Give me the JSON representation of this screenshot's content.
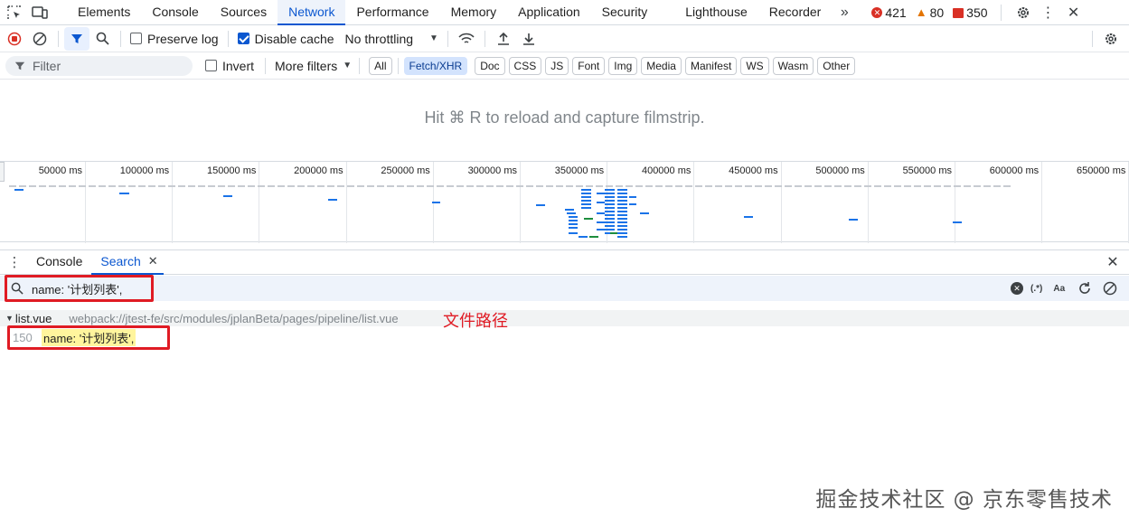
{
  "tabs": [
    "Elements",
    "Console",
    "Sources",
    "Network",
    "Performance",
    "Memory",
    "Application",
    "Security",
    "Lighthouse",
    "Recorder"
  ],
  "active_tab": "Network",
  "counters": {
    "errors": "421",
    "warnings": "80",
    "issues": "350"
  },
  "toolbar": {
    "preserve_log": "Preserve log",
    "disable_cache": "Disable cache",
    "throttling": "No throttling"
  },
  "filterbar": {
    "filter_placeholder": "Filter",
    "invert": "Invert",
    "more_filters": "More filters",
    "chips": [
      "All",
      "Fetch/XHR",
      "Doc",
      "CSS",
      "JS",
      "Font",
      "Img",
      "Media",
      "Manifest",
      "WS",
      "Wasm",
      "Other"
    ],
    "active_chip": "Fetch/XHR"
  },
  "filmstrip_message": "Hit ⌘ R to reload and capture filmstrip.",
  "timeline_ticks": [
    "50000 ms",
    "100000 ms",
    "150000 ms",
    "200000 ms",
    "250000 ms",
    "300000 ms",
    "350000 ms",
    "400000 ms",
    "450000 ms",
    "500000 ms",
    "550000 ms",
    "600000 ms",
    "650000 ms"
  ],
  "drawer": {
    "tabs": [
      "Console",
      "Search"
    ],
    "active_tab": "Search",
    "search_query": "name: '计划列表',",
    "regex_label": "(.*)",
    "case_label": "Aa"
  },
  "result": {
    "file": "list.vue",
    "path": "webpack://jtest-fe/src/modules/jplanBeta/pages/pipeline/list.vue",
    "line_number": "150",
    "match_text": "name: '计划列表',"
  },
  "annotation": "文件路径",
  "watermark": "掘金技术社区 @ 京东零售技术",
  "colors": {
    "accent": "#0b57d0",
    "error": "#d93025",
    "warning": "#e37400",
    "annotation_red": "#e01b24"
  }
}
